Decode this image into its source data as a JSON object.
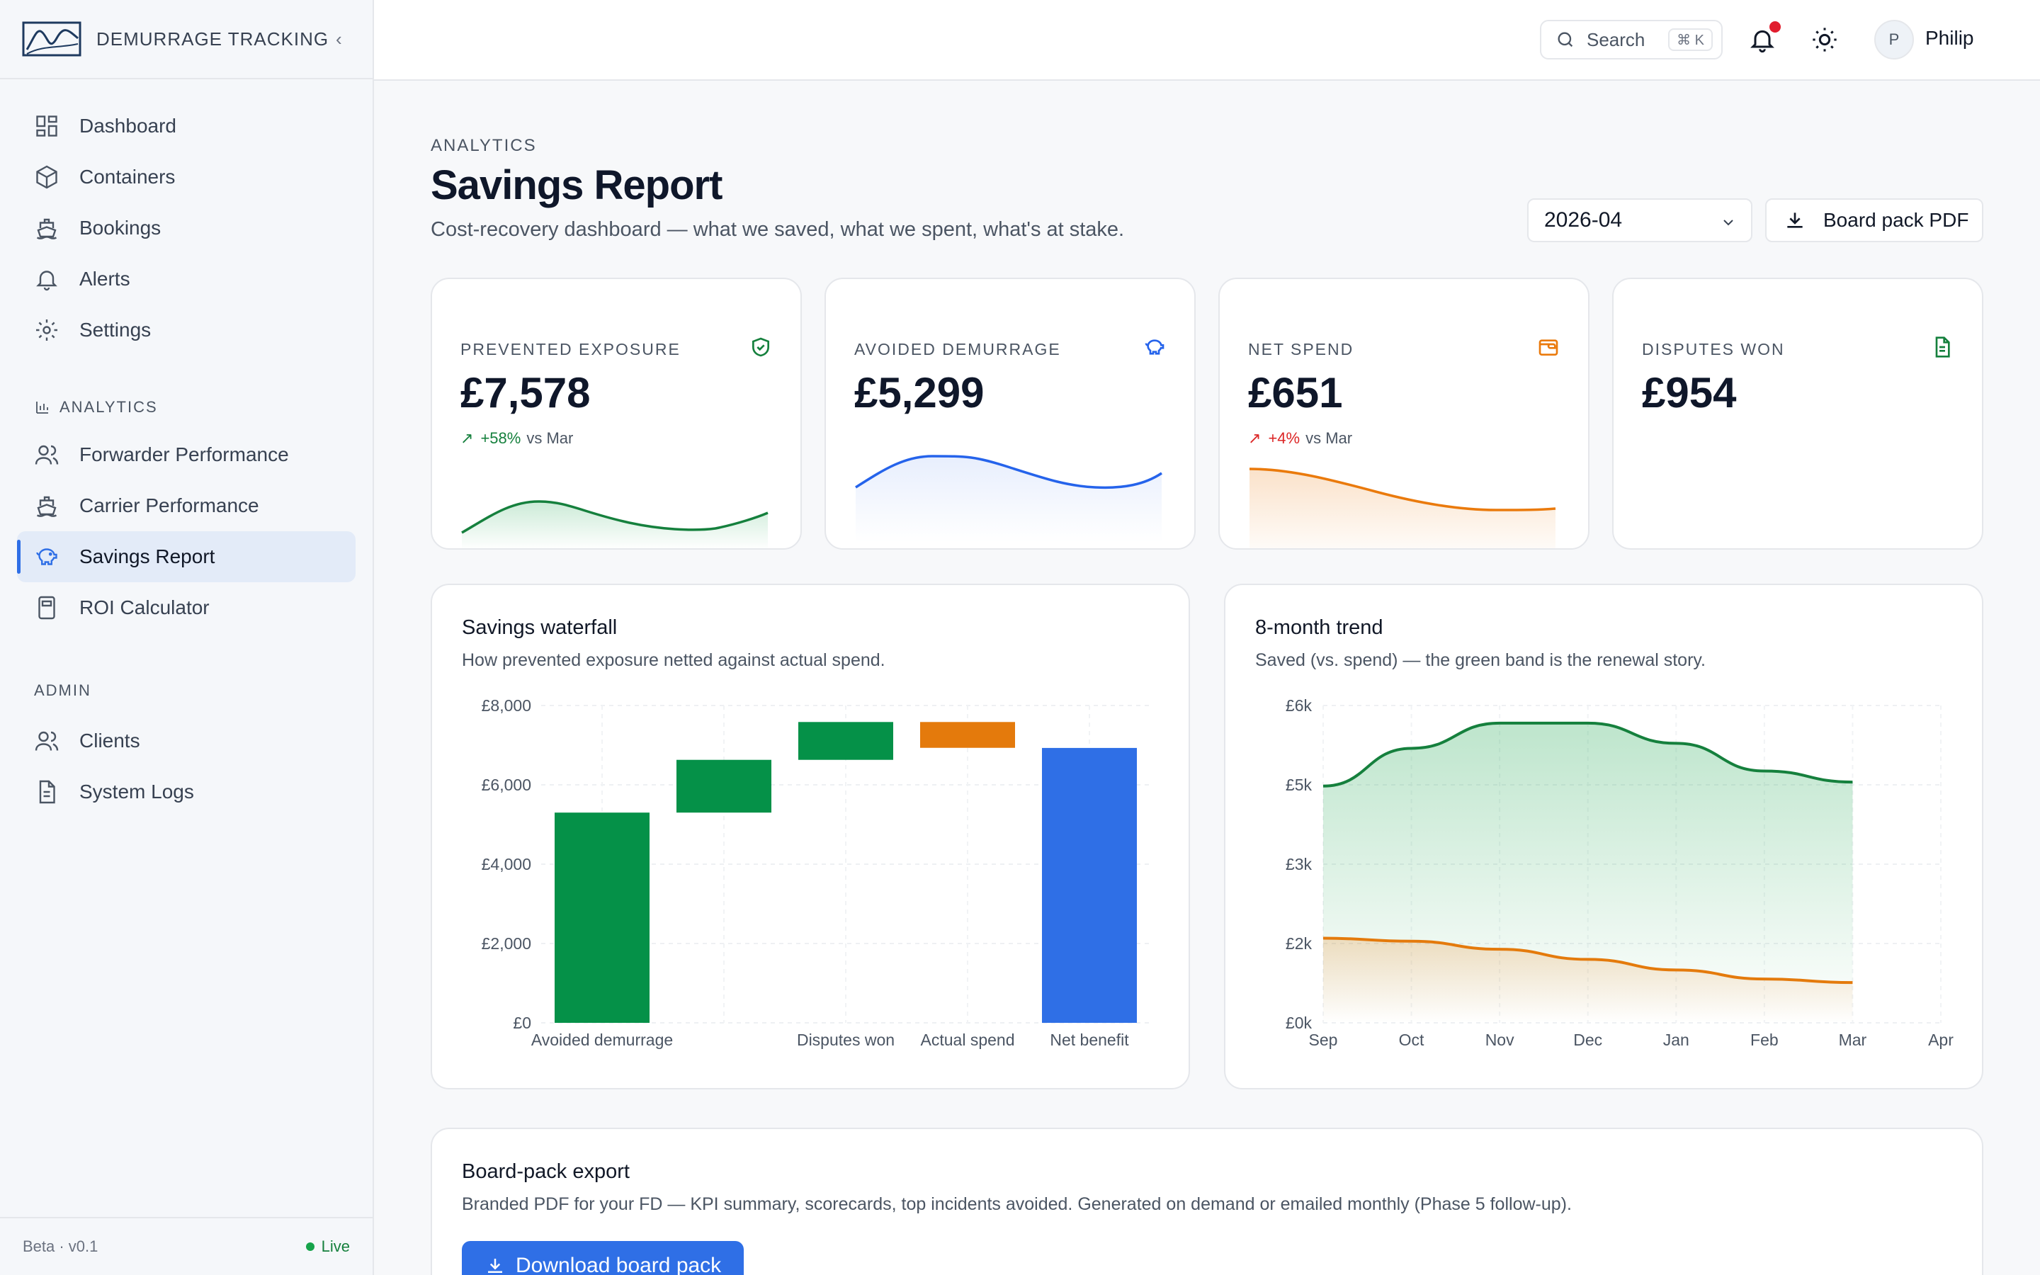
{
  "brand": {
    "name": "DEMURRAGE TRACKING",
    "collapse_icon": "chevron-left-icon"
  },
  "sidebar": {
    "items": [
      {
        "label": "Dashboard",
        "icon": "grid-icon"
      },
      {
        "label": "Containers",
        "icon": "box-icon"
      },
      {
        "label": "Bookings",
        "icon": "ship-icon"
      },
      {
        "label": "Alerts",
        "icon": "bell-icon"
      },
      {
        "label": "Settings",
        "icon": "gear-icon"
      }
    ],
    "analytics_title": "ANALYTICS",
    "analytics_items": [
      {
        "label": "Forwarder Performance",
        "icon": "users-icon"
      },
      {
        "label": "Carrier Performance",
        "icon": "ship-icon"
      },
      {
        "label": "Savings Report",
        "icon": "piggy-bank-icon",
        "active": true
      },
      {
        "label": "ROI Calculator",
        "icon": "calculator-icon"
      }
    ],
    "admin_title": "ADMIN",
    "admin_items": [
      {
        "label": "Clients",
        "icon": "users-icon"
      },
      {
        "label": "System Logs",
        "icon": "file-icon"
      }
    ],
    "footer_version": "Beta · v0.1",
    "footer_status": "Live"
  },
  "topbar": {
    "search_label": "Search",
    "search_shortcut": "⌘ K",
    "user_initial": "P",
    "user_name": "Philip"
  },
  "header": {
    "eyebrow": "ANALYTICS",
    "title": "Savings Report",
    "subtitle": "Cost-recovery dashboard — what we saved, what we spent, what's at stake.",
    "period": "2026-04",
    "pdf_button": "Board pack PDF"
  },
  "kpis": [
    {
      "label": "PREVENTED EXPOSURE",
      "value": "£7,578",
      "delta": "+58%",
      "delta_suffix": "vs Mar",
      "icon": "shield-check-icon",
      "color": "#15803d"
    },
    {
      "label": "AVOIDED DEMURRAGE",
      "value": "£5,299",
      "delta": "",
      "delta_suffix": "",
      "icon": "piggy-bank-icon",
      "color": "#2563eb"
    },
    {
      "label": "NET SPEND",
      "value": "£651",
      "delta": "+4%",
      "delta_suffix": "vs Mar",
      "icon": "wallet-icon",
      "color": "#dc2626"
    },
    {
      "label": "DISPUTES WON",
      "value": "£954",
      "delta": "",
      "delta_suffix": "",
      "icon": "document-icon",
      "color": "#15803d"
    }
  ],
  "waterfall_panel": {
    "title": "Savings waterfall",
    "subtitle": "How prevented exposure netted against actual spend."
  },
  "trend_panel": {
    "title": "8-month trend",
    "subtitle": "Saved (vs. spend) — the green band is the renewal story."
  },
  "export_panel": {
    "title": "Board-pack export",
    "subtitle": "Branded PDF for your FD — KPI summary, scorecards, top incidents avoided. Generated on demand or emailed monthly (Phase 5 follow-up).",
    "button": "Download board pack"
  },
  "colors": {
    "accent": "#2f6fe6",
    "green": "#059148",
    "orange": "#e47a0c",
    "blue": "#2f6fe6"
  },
  "chart_data": [
    {
      "type": "bar",
      "subtype": "waterfall",
      "categories": [
        "Avoided demurrage",
        "",
        "Disputes won",
        "Actual spend",
        "Net benefit"
      ],
      "series": [
        {
          "values": [
            5300,
            1330,
            954,
            -651,
            6930
          ]
        }
      ],
      "bar_ranges": [
        [
          0,
          5300
        ],
        [
          5300,
          6630
        ],
        [
          6630,
          7584
        ],
        [
          6933,
          7584
        ],
        [
          0,
          6930
        ]
      ],
      "bar_colors": [
        "#059148",
        "#059148",
        "#059148",
        "#e47a0c",
        "#2f6fe6"
      ],
      "y_ticks": [
        "£0",
        "£2,000",
        "£4,000",
        "£6,000",
        "£8,000"
      ],
      "ylim": [
        0,
        8000
      ],
      "grid": true
    },
    {
      "type": "area",
      "x": [
        "Sep",
        "Oct",
        "Nov",
        "Dec",
        "Jan",
        "Feb",
        "Mar",
        "Apr"
      ],
      "series": [
        {
          "values": [
            4700,
            5450,
            5950,
            5950,
            5550,
            5000,
            4780
          ],
          "color": "#15803d"
        },
        {
          "values": [
            1680,
            1620,
            1460,
            1260,
            1050,
            870,
            800
          ],
          "color": "#e47a0c"
        }
      ],
      "y_ticks": [
        "£0k",
        "£2k",
        "£3k",
        "£5k",
        "£6k"
      ],
      "ylim": [
        0,
        6300
      ],
      "grid": true
    }
  ]
}
